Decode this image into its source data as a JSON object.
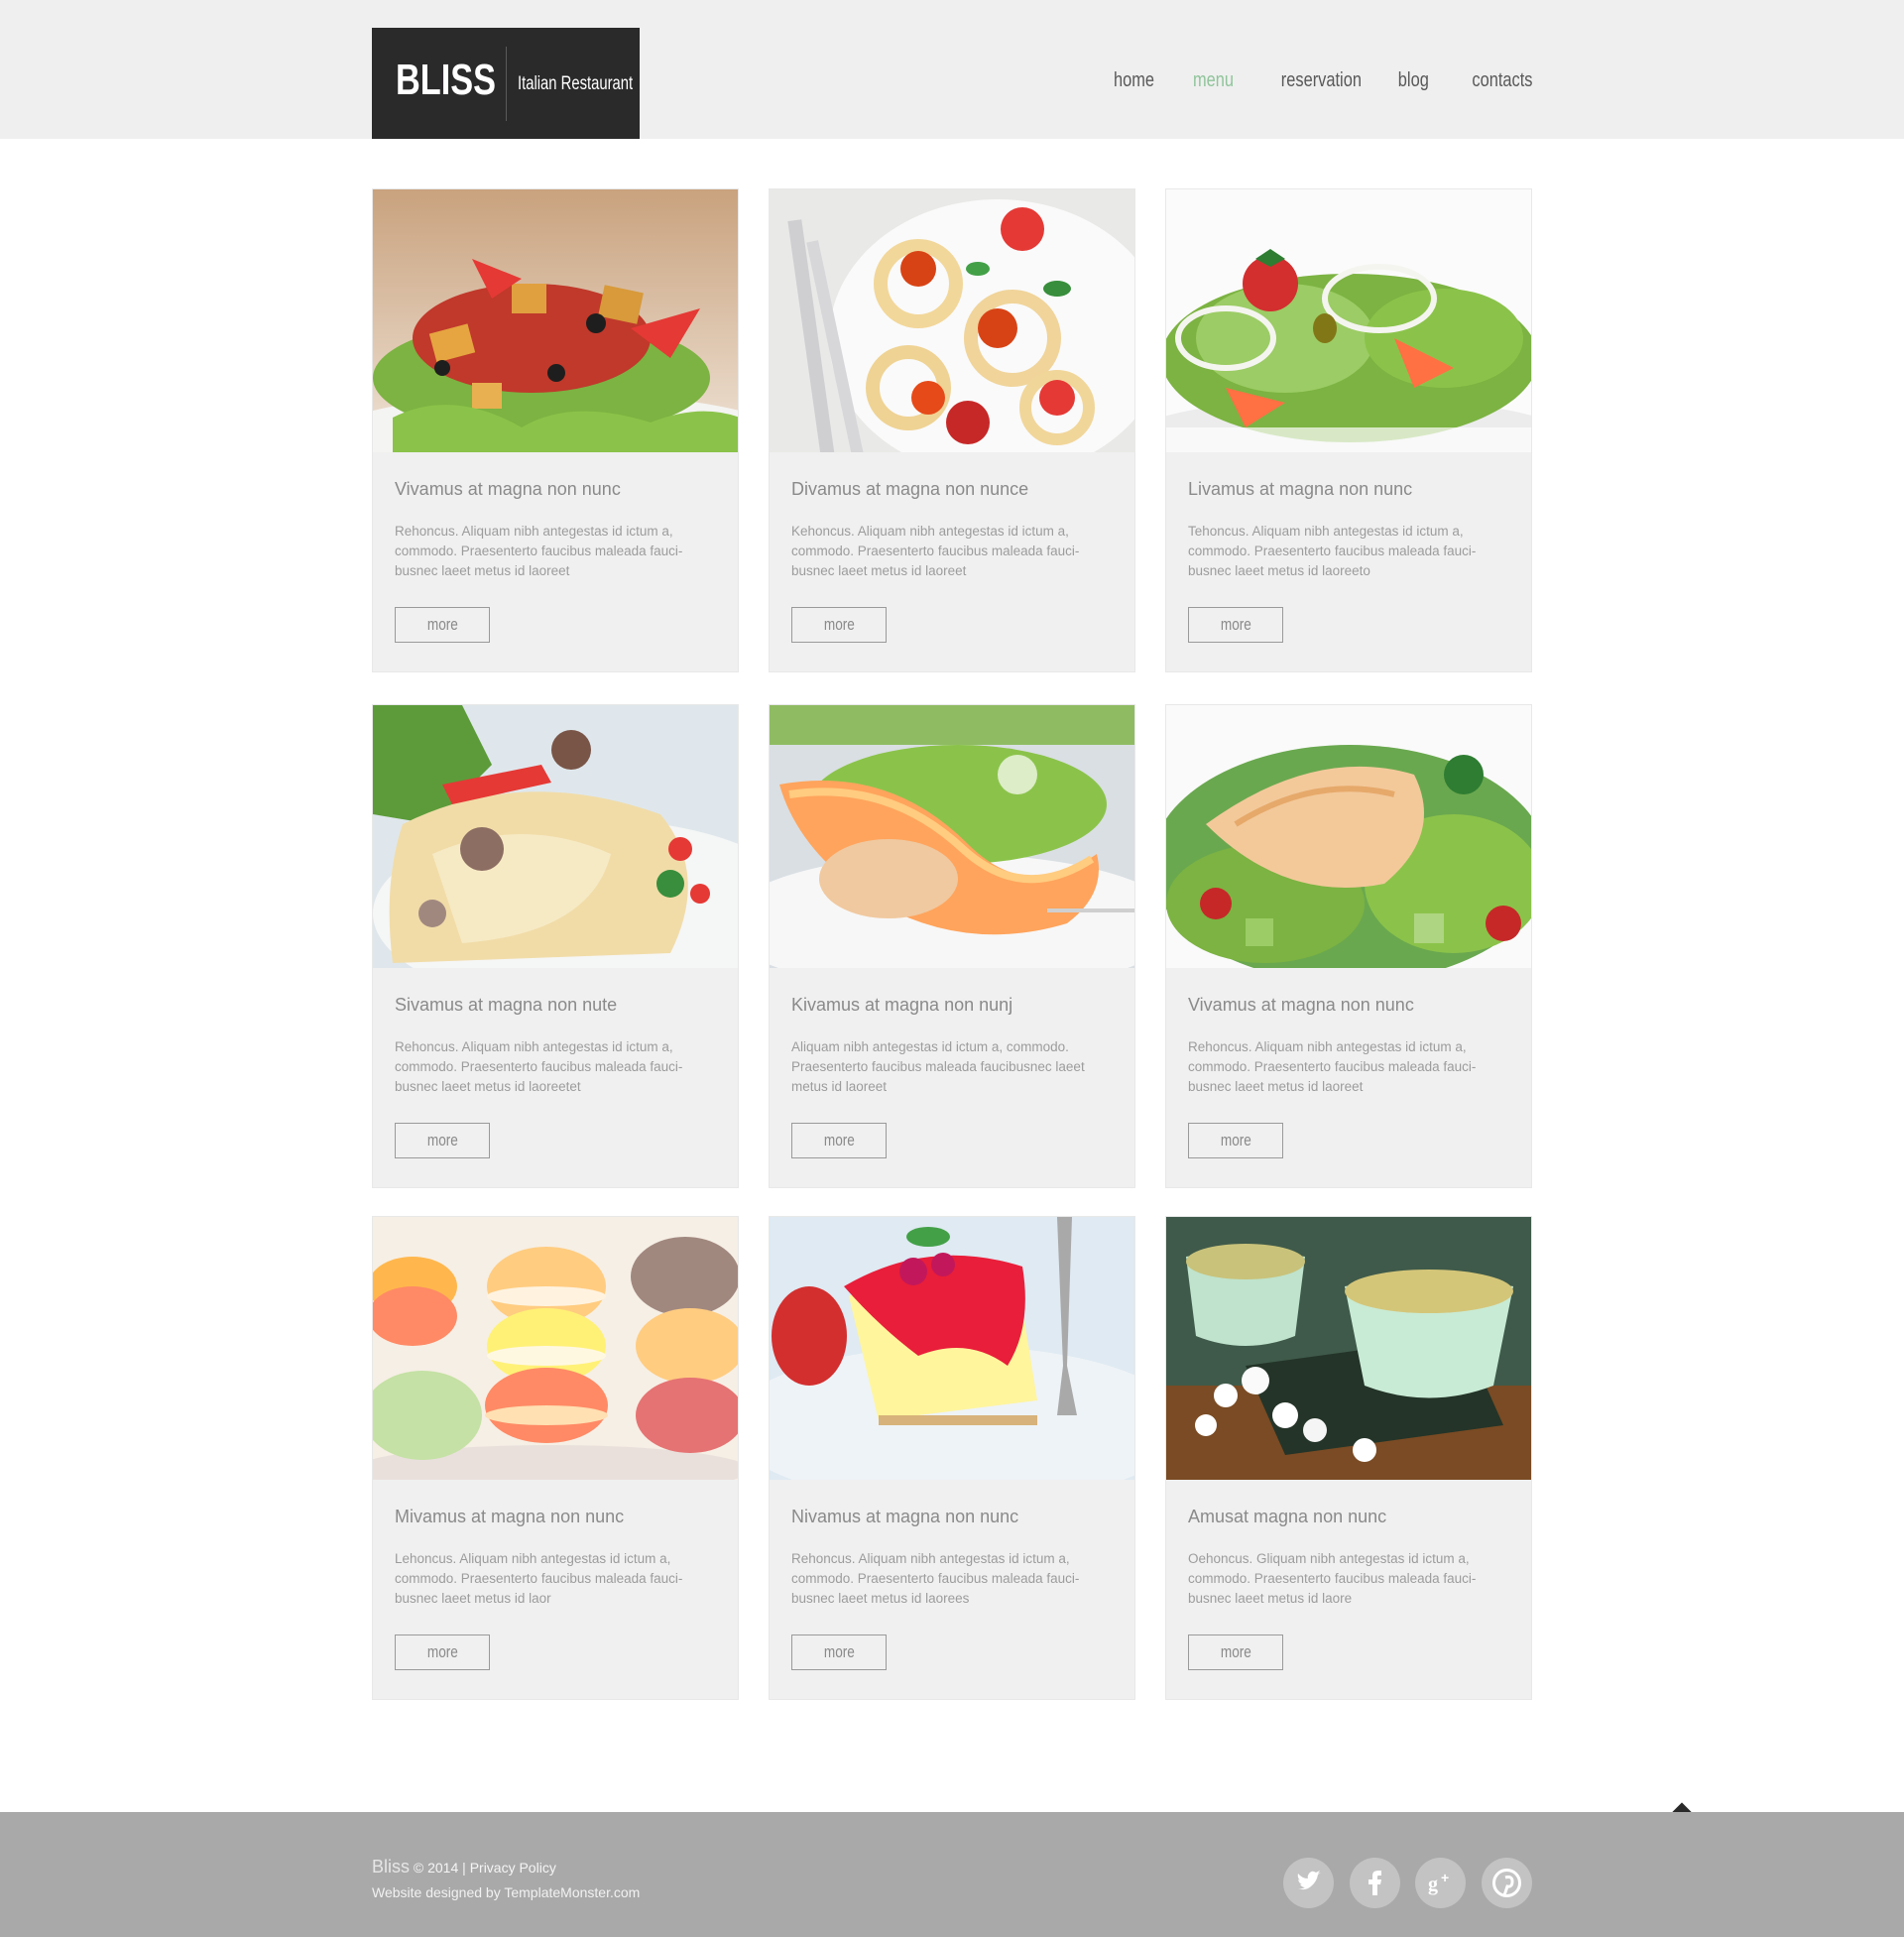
{
  "header": {
    "logo_name": "BLISS",
    "logo_subtitle": "Italian Restaurant",
    "nav": [
      {
        "label": "home",
        "active": false
      },
      {
        "label": "menu",
        "active": true
      },
      {
        "label": "reservation",
        "active": false
      },
      {
        "label": "blog",
        "active": false
      },
      {
        "label": "contacts",
        "active": false
      }
    ]
  },
  "menu": {
    "more_label": "more",
    "items": [
      {
        "title": "Vivamus at magna non nunc",
        "text": "Rehoncus. Aliquam nibh antegestas id ictum a, commodo. Praesenterto faucibus maleada fauci-busnec laeet metus id laoreet",
        "image": "salad-croutons"
      },
      {
        "title": "Divamus at magna non nunce",
        "text": "Kehoncus. Aliquam nibh antegestas id ictum a, commodo. Praesenterto faucibus maleada fauci-busnec laeet metus id laoreet",
        "image": "pasta-tomatoes"
      },
      {
        "title": "Livamus at magna non nunc",
        "text": "Tehoncus. Aliquam nibh antegestas id ictum a, commodo. Praesenterto faucibus maleada fauci-busnec laeet metus id laoreeto",
        "image": "green-salad"
      },
      {
        "title": "Sivamus at magna non nute",
        "text": "Rehoncus. Aliquam nibh antegestas id ictum a, commodo. Praesenterto faucibus maleada fauci-busnec laeet metus id laoreetet",
        "image": "crepes"
      },
      {
        "title": "Kivamus at magna non nunj",
        "text": "Aliquam nibh antegestas id ictum a, commodo. Praesenterto faucibus maleada faucibusnec laeet metus id laoreet",
        "image": "melon-salad"
      },
      {
        "title": "Vivamus at magna non nunc",
        "text": "Rehoncus. Aliquam nibh antegestas id ictum a, commodo. Praesenterto faucibus maleada fauci-busnec laeet metus id laoreet",
        "image": "chicken-salad"
      },
      {
        "title": "Mivamus at magna non nunc",
        "text": "Lehoncus. Aliquam nibh antegestas id ictum a, commodo. Praesenterto faucibus maleada fauci-busnec laeet metus id laor",
        "image": "macarons"
      },
      {
        "title": "Nivamus at magna non nunc",
        "text": "Rehoncus. Aliquam nibh antegestas id ictum a, commodo. Praesenterto faucibus maleada fauci-busnec laeet metus id laorees",
        "image": "cheesecake"
      },
      {
        "title": "Amusat magna non nunc",
        "text": "Oehoncus. Gliquam nibh antegestas id ictum a, commodo. Praesenterto faucibus maleada fauci-busnec laeet metus id laore",
        "image": "tea-cups"
      }
    ]
  },
  "footer": {
    "brand": "Bliss",
    "copyright": "© 2014 |",
    "privacy_link": "Privacy Policy",
    "credit": "Website designed by TemplateMonster.com",
    "social": [
      {
        "icon": "twitter-icon",
        "glyph": "t"
      },
      {
        "icon": "facebook-icon",
        "glyph": "f"
      },
      {
        "icon": "google-plus-icon",
        "glyph": "g+"
      },
      {
        "icon": "pinterest-icon",
        "glyph": "p"
      }
    ]
  },
  "colors": {
    "accent": "#8fc49a",
    "header_bg": "#efefef",
    "logo_bg": "#2b2a2b",
    "card_bg": "#f0f0f0",
    "footer_bg": "#a9a9aa"
  }
}
